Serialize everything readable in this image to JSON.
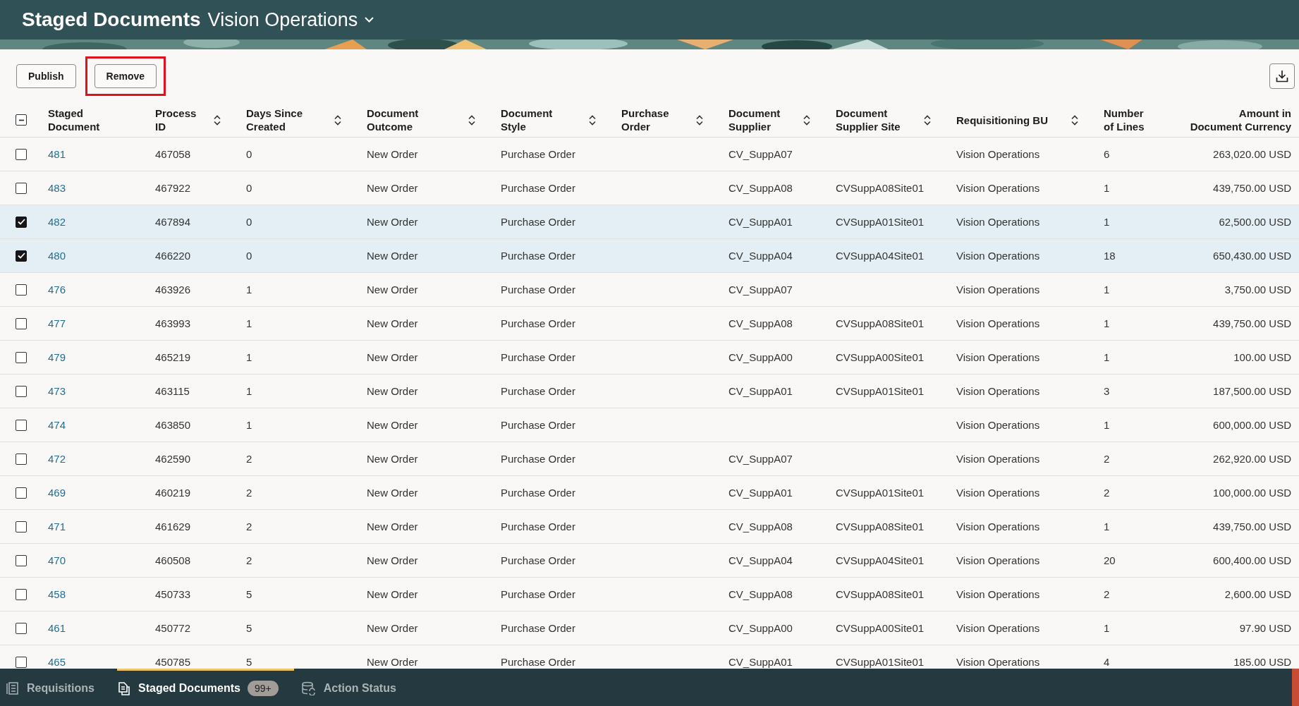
{
  "header": {
    "title": "Staged Documents",
    "business_unit": "Vision Operations"
  },
  "toolbar": {
    "buttons": [
      {
        "label": "Publish",
        "highlighted": false
      },
      {
        "label": "Remove",
        "highlighted": true
      }
    ]
  },
  "table": {
    "select_all": {
      "indeterminate": true
    },
    "columns": [
      {
        "label": "Staged Document",
        "kind": "link",
        "sortable": false
      },
      {
        "label": "Process ID",
        "kind": "text",
        "sortable": true
      },
      {
        "label": "Days Since Created",
        "kind": "text",
        "sortable": true
      },
      {
        "label": "Document Outcome",
        "kind": "text",
        "sortable": true
      },
      {
        "label": "Document Style",
        "kind": "text",
        "sortable": true
      },
      {
        "label": "Purchase Order",
        "kind": "text",
        "sortable": true
      },
      {
        "label": "Document Supplier",
        "kind": "text",
        "sortable": true
      },
      {
        "label": "Document Supplier Site",
        "kind": "text",
        "sortable": true
      },
      {
        "label": "Requisitioning BU",
        "kind": "text",
        "sortable": true
      },
      {
        "label": "Number of Lines",
        "kind": "text",
        "sortable": false
      },
      {
        "label": "Amount in Document Currency",
        "kind": "amount",
        "sortable": false
      }
    ],
    "rows": [
      {
        "selected": false,
        "cells": [
          "481",
          "467058",
          "0",
          "New Order",
          "Purchase Order",
          null,
          "CV_SuppA07",
          null,
          "Vision Operations",
          "6",
          "263,020.00 USD"
        ]
      },
      {
        "selected": false,
        "cells": [
          "483",
          "467922",
          "0",
          "New Order",
          "Purchase Order",
          null,
          "CV_SuppA08",
          "CVSuppA08Site01",
          "Vision Operations",
          "1",
          "439,750.00 USD"
        ]
      },
      {
        "selected": true,
        "cells": [
          "482",
          "467894",
          "0",
          "New Order",
          "Purchase Order",
          null,
          "CV_SuppA01",
          "CVSuppA01Site01",
          "Vision Operations",
          "1",
          "62,500.00 USD"
        ]
      },
      {
        "selected": true,
        "cells": [
          "480",
          "466220",
          "0",
          "New Order",
          "Purchase Order",
          null,
          "CV_SuppA04",
          "CVSuppA04Site01",
          "Vision Operations",
          "18",
          "650,430.00 USD"
        ]
      },
      {
        "selected": false,
        "cells": [
          "476",
          "463926",
          "1",
          "New Order",
          "Purchase Order",
          null,
          "CV_SuppA07",
          null,
          "Vision Operations",
          "1",
          "3,750.00 USD"
        ]
      },
      {
        "selected": false,
        "cells": [
          "477",
          "463993",
          "1",
          "New Order",
          "Purchase Order",
          null,
          "CV_SuppA08",
          "CVSuppA08Site01",
          "Vision Operations",
          "1",
          "439,750.00 USD"
        ]
      },
      {
        "selected": false,
        "cells": [
          "479",
          "465219",
          "1",
          "New Order",
          "Purchase Order",
          null,
          "CV_SuppA00",
          "CVSuppA00Site01",
          "Vision Operations",
          "1",
          "100.00 USD"
        ]
      },
      {
        "selected": false,
        "cells": [
          "473",
          "463115",
          "1",
          "New Order",
          "Purchase Order",
          null,
          "CV_SuppA01",
          "CVSuppA01Site01",
          "Vision Operations",
          "3",
          "187,500.00 USD"
        ]
      },
      {
        "selected": false,
        "cells": [
          "474",
          "463850",
          "1",
          "New Order",
          "Purchase Order",
          null,
          null,
          null,
          "Vision Operations",
          "1",
          "600,000.00 USD"
        ]
      },
      {
        "selected": false,
        "cells": [
          "472",
          "462590",
          "2",
          "New Order",
          "Purchase Order",
          null,
          "CV_SuppA07",
          null,
          "Vision Operations",
          "2",
          "262,920.00 USD"
        ]
      },
      {
        "selected": false,
        "cells": [
          "469",
          "460219",
          "2",
          "New Order",
          "Purchase Order",
          null,
          "CV_SuppA01",
          "CVSuppA01Site01",
          "Vision Operations",
          "2",
          "100,000.00 USD"
        ]
      },
      {
        "selected": false,
        "cells": [
          "471",
          "461629",
          "2",
          "New Order",
          "Purchase Order",
          null,
          "CV_SuppA08",
          "CVSuppA08Site01",
          "Vision Operations",
          "1",
          "439,750.00 USD"
        ]
      },
      {
        "selected": false,
        "cells": [
          "470",
          "460508",
          "2",
          "New Order",
          "Purchase Order",
          null,
          "CV_SuppA04",
          "CVSuppA04Site01",
          "Vision Operations",
          "20",
          "600,400.00 USD"
        ]
      },
      {
        "selected": false,
        "cells": [
          "458",
          "450733",
          "5",
          "New Order",
          "Purchase Order",
          null,
          "CV_SuppA08",
          "CVSuppA08Site01",
          "Vision Operations",
          "2",
          "2,600.00 USD"
        ]
      },
      {
        "selected": false,
        "cells": [
          "461",
          "450772",
          "5",
          "New Order",
          "Purchase Order",
          null,
          "CV_SuppA00",
          "CVSuppA00Site01",
          "Vision Operations",
          "1",
          "97.90 USD"
        ]
      },
      {
        "selected": false,
        "cells": [
          "465",
          "450785",
          "5",
          "New Order",
          "Purchase Order",
          null,
          "CV_SuppA01",
          "CVSuppA01Site01",
          "Vision Operations",
          "4",
          "185.00 USD"
        ]
      }
    ]
  },
  "bottom_nav": [
    {
      "label": "Requisitions",
      "selected": false
    },
    {
      "label": "Staged Documents",
      "selected": true,
      "badge": "99+"
    },
    {
      "label": "Action Status",
      "selected": false
    }
  ]
}
